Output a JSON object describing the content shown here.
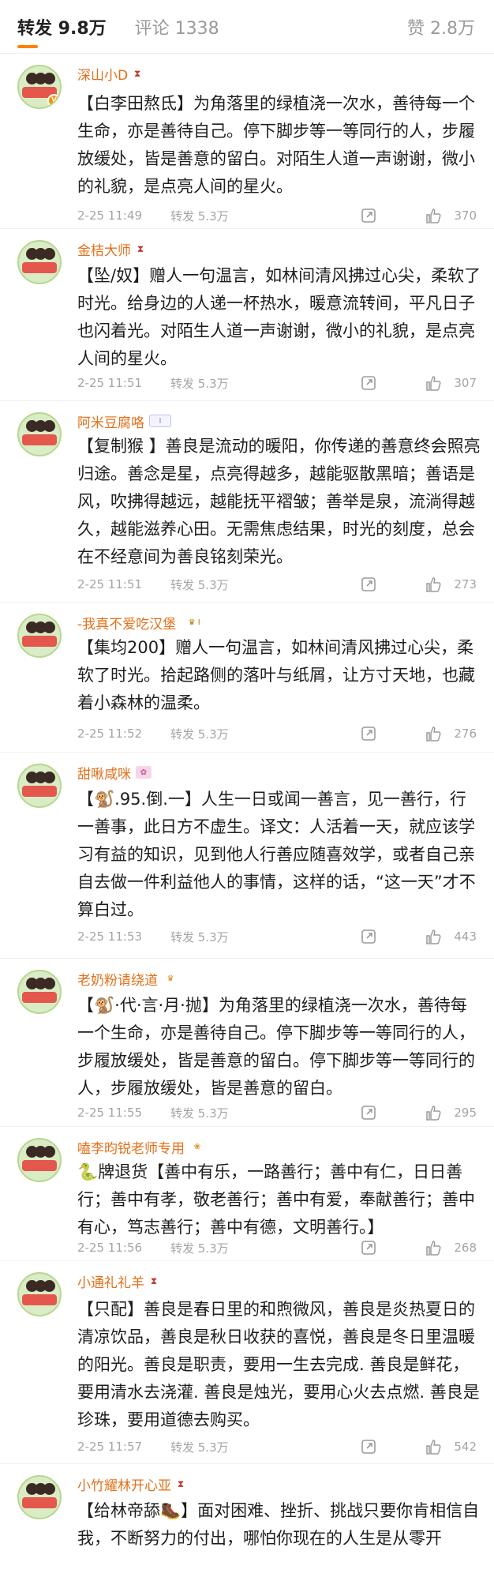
{
  "tabs": {
    "repost": "转发 9.8万",
    "comments": "评论 1338",
    "likes": "赞 2.8万"
  },
  "colors": {
    "accent": "#ff8200",
    "username": "#e2701a",
    "meta_text": "#a5a5a5"
  },
  "comments": [
    {
      "name": "深山小D",
      "badge": "hourglass-icon",
      "text": "【白李田熬氐】为角落里的绿植浇一次水，善待每一个生命，亦是善待自己。停下脚步等一等同行的人，步履放缓处，皆是善意的留白。对陌生人道一声谢谢，微小的礼貌，是点亮人间的星火。",
      "time": "2-25 11:49",
      "repost": "转发 5.3万",
      "likes": "370"
    },
    {
      "name": "金桔大师",
      "badge": "hourglass-icon",
      "text": "【坠/奴】赠人一句温言，如林间清风拂过心尖，柔软了时光。给身边的人递一杯热水，暖意流转间，平凡日子也闪着光。对陌生人道一声谢谢，微小的礼貌，是点亮人间的星火。",
      "time": "2-25 11:51",
      "repost": "转发 5.3万",
      "likes": "307"
    },
    {
      "name": "阿米豆腐咯",
      "badge_text": "I",
      "text": "【复制猴 】善良是流动的暖阳，你传递的善意终会照亮归途。善念是星，点亮得越多，越能驱散黑暗；善语是风，吹拂得越远，越能抚平褶皱；善举是泉，流淌得越久，越能滋养心田。无需焦虑结果，时光的刻度，总会在不经意间为善良铭刻荣光。",
      "time": "2-25 11:51",
      "repost": "转发 5.3万",
      "likes": "273"
    },
    {
      "name": "-我真不爱吃汉堡",
      "badge_text": "♛ I",
      "text": "【集均200】赠人一句温言，如林间清风拂过心尖，柔软了时光。拾起路侧的落叶与纸屑，让方寸天地，也藏着小森林的温柔。",
      "time": "2-25 11:52",
      "repost": "转发 5.3万",
      "likes": "276"
    },
    {
      "name": "甜啾咸咪",
      "badge": "pink-badge-icon",
      "text": "【🐒.95.倒.一】人生一日或闻一善言，见一善行，行一善事，此日方不虚生。译文：人活着一天，就应该学习有益的知识，见到他人行善应随喜效学，或者自己亲自去做一件利益他人的事情，这样的话，“这一天”才不算白过。",
      "time": "2-25 11:53",
      "repost": "转发 5.3万",
      "likes": "443"
    },
    {
      "name": "老奶粉请绕道",
      "badge": "crown-badge-icon",
      "text": "【🐒·代·言·月·抛】为角落里的绿植浇一次水，善待每一个生命，亦是善待自己。停下脚步等一等同行的人，步履放缓处，皆是善意的留白。停下脚步等一等同行的人，步履放缓处，皆是善意的留白。",
      "time": "2-25 11:55",
      "repost": "转发 5.3万",
      "likes": "295"
    },
    {
      "name": "嗑李昀锐老师专用",
      "badge": "fan-badge-icon",
      "text": "🐍牌退货【善中有乐，一路善行；善中有仁，日日善行；善中有孝，敬老善行；善中有爱，奉献善行；善中有心，笃志善行；善中有德，文明善行。】",
      "time": "2-25 11:56",
      "repost": "转发 5.3万",
      "likes": "268"
    },
    {
      "name": "小通礼礼羊",
      "badge": "hourglass-icon",
      "text": "【只配】善良是春日里的和煦微风，善良是炎热夏日的清凉饮品，善良是秋日收获的喜悦，善良是冬日里温暖的阳光。善良是职责，要用一生去完成. 善良是鲜花，要用清水去浇灌. 善良是烛光，要用心火去点燃. 善良是珍珠，要用道德去购买。",
      "time": "2-25 11:57",
      "repost": "转发 5.3万",
      "likes": "542"
    },
    {
      "name": "小竹耀林开心亚",
      "badge": "hourglass-icon",
      "text": "【给林帝舔🥾】面对困难、挫折、挑战只要你肯相信自我，不断努力的付出，哪怕你现在的人生是从零开"
    }
  ]
}
